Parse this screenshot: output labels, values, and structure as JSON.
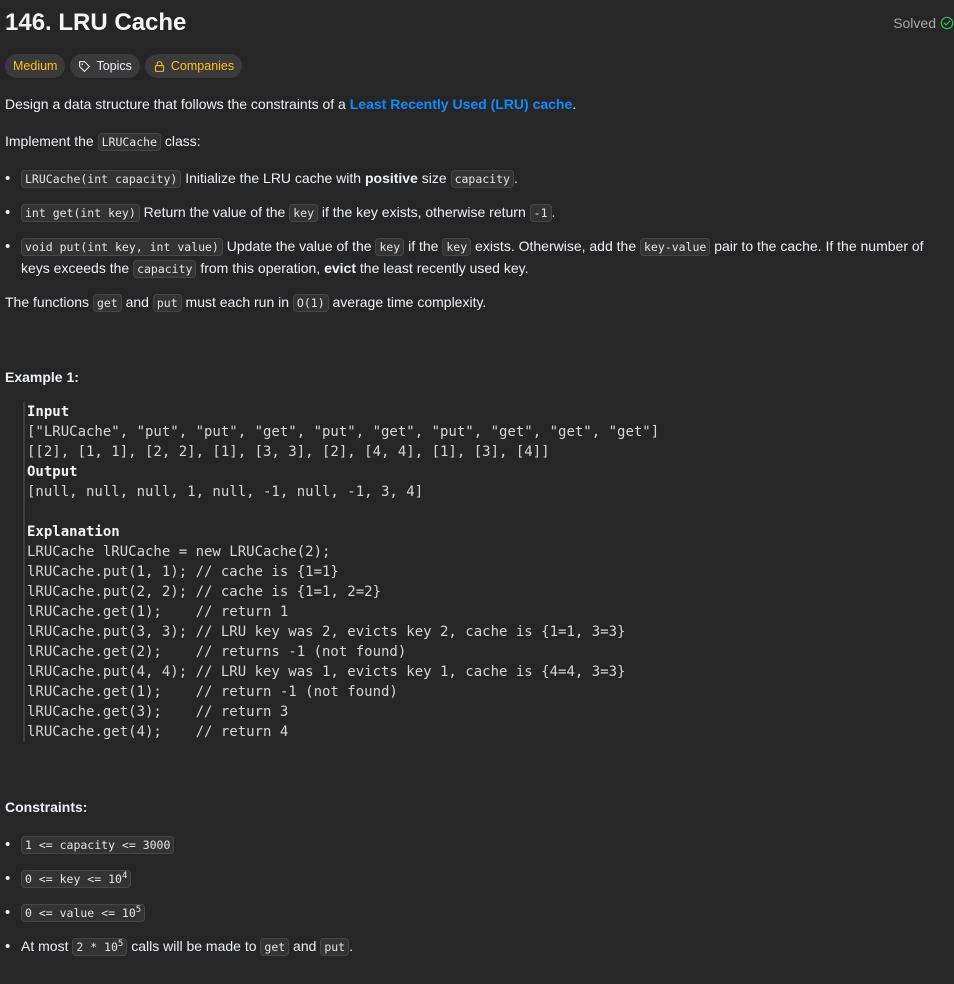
{
  "problem": {
    "title": "146. LRU Cache",
    "status": "Solved",
    "tags": {
      "difficulty": "Medium",
      "topics": "Topics",
      "companies": "Companies"
    }
  },
  "description": {
    "intro_pre": "Design a data structure that follows the constraints of a ",
    "intro_link": "Least Recently Used (LRU) cache",
    "intro_post": ".",
    "implement_pre": "Implement the ",
    "implement_code": "LRUCache",
    "implement_post": " class:",
    "bullets": [
      {
        "code": "LRUCache(int capacity)",
        "t1": " Initialize the LRU cache with ",
        "bold": "positive",
        "t2": " size ",
        "code2": "capacity",
        "t3": "."
      },
      {
        "code": "int get(int key)",
        "t1": " Return the value of the ",
        "code2": "key",
        "t2": " if the key exists, otherwise return ",
        "code3": "-1",
        "t3": "."
      },
      {
        "code": "void put(int key, int value)",
        "t1": " Update the value of the ",
        "code2": "key",
        "t2": " if the ",
        "code3": "key",
        "t3": " exists. Otherwise, add the ",
        "code4": "key-value",
        "t4": " pair to the cache. If the number of keys exceeds the ",
        "code5": "capacity",
        "t5": " from this operation, ",
        "bold": "evict",
        "t6": " the least recently used key."
      }
    ],
    "complexity_pre": "The functions ",
    "complexity_code1": "get",
    "complexity_mid": " and ",
    "complexity_code2": "put",
    "complexity_mid2": " must each run in ",
    "complexity_code3": "O(1)",
    "complexity_post": " average time complexity."
  },
  "example": {
    "heading": "Example 1:",
    "lines": [
      {
        "text": "Input",
        "label": true
      },
      {
        "text": "[\"LRUCache\", \"put\", \"put\", \"get\", \"put\", \"get\", \"put\", \"get\", \"get\", \"get\"]"
      },
      {
        "text": "[[2], [1, 1], [2, 2], [1], [3, 3], [2], [4, 4], [1], [3], [4]]"
      },
      {
        "text": "Output",
        "label": true
      },
      {
        "text": "[null, null, null, 1, null, -1, null, -1, 3, 4]"
      },
      {
        "text": ""
      },
      {
        "text": "Explanation",
        "label": true
      },
      {
        "text": "LRUCache lRUCache = new LRUCache(2);"
      },
      {
        "text": "lRUCache.put(1, 1); // cache is {1=1}"
      },
      {
        "text": "lRUCache.put(2, 2); // cache is {1=1, 2=2}"
      },
      {
        "text": "lRUCache.get(1);    // return 1"
      },
      {
        "text": "lRUCache.put(3, 3); // LRU key was 2, evicts key 2, cache is {1=1, 3=3}"
      },
      {
        "text": "lRUCache.get(2);    // returns -1 (not found)"
      },
      {
        "text": "lRUCache.put(4, 4); // LRU key was 1, evicts key 1, cache is {4=4, 3=3}"
      },
      {
        "text": "lRUCache.get(1);    // return -1 (not found)"
      },
      {
        "text": "lRUCache.get(3);    // return 3"
      },
      {
        "text": "lRUCache.get(4);    // return 4"
      }
    ]
  },
  "constraints": {
    "heading": "Constraints:",
    "c1": "1 <= capacity <= 3000",
    "c2_base": "0 <= key <= 10",
    "c2_exp": "4",
    "c3_base": "0 <= value <= 10",
    "c3_exp": "5",
    "c4_pre": "At most ",
    "c4_code_base": "2 * 10",
    "c4_code_exp": "5",
    "c4_mid": " calls will be made to ",
    "c4_code2": "get",
    "c4_and": " and ",
    "c4_code3": "put",
    "c4_post": "."
  },
  "colors": {
    "background": "#262626",
    "medium": "#ffc01e",
    "link": "#0d8bff",
    "solved_check": "#2cbb5d"
  }
}
